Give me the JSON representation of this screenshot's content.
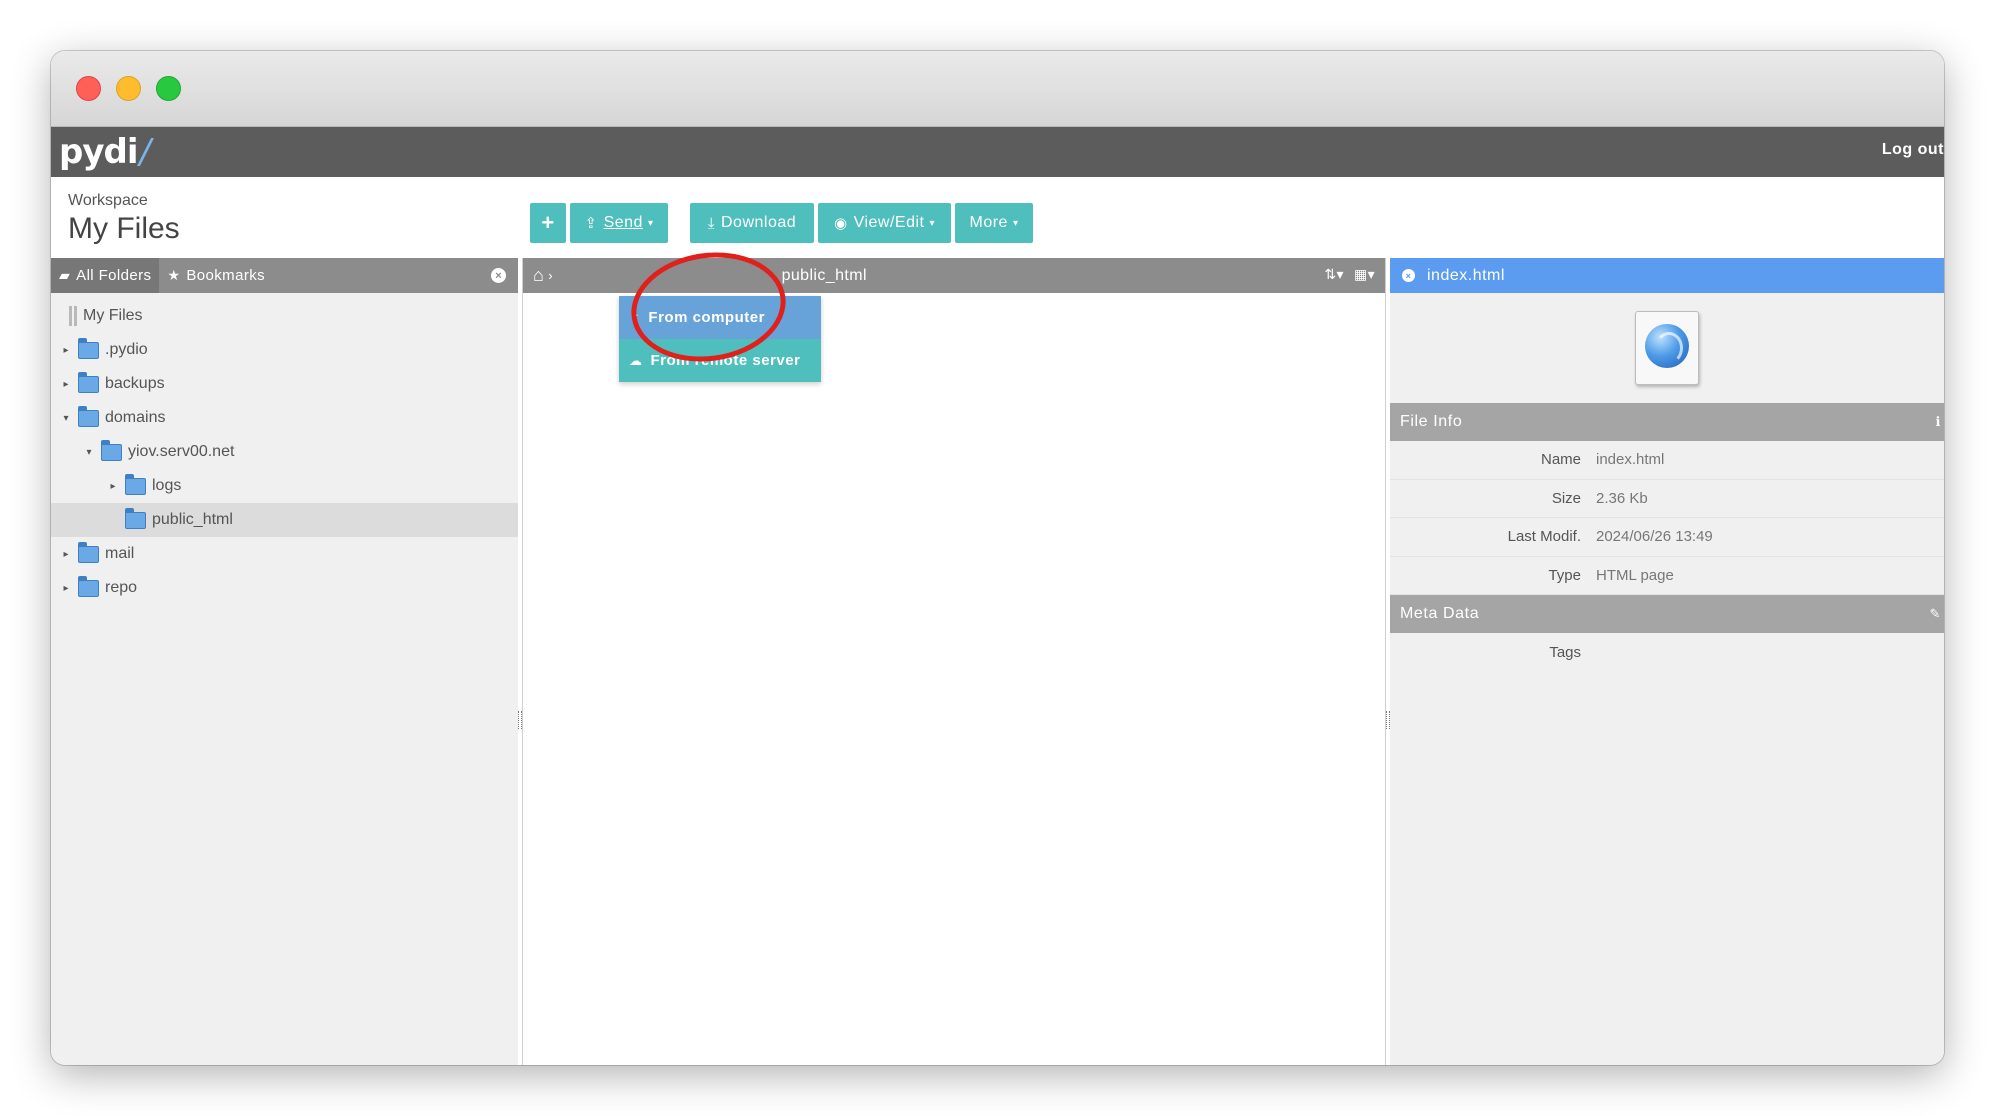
{
  "app": {
    "logo_text": "pydi",
    "logout_label": "Log out"
  },
  "workspace": {
    "label": "Workspace",
    "title": "My Files"
  },
  "toolbar": {
    "add_icon": "plus-icon",
    "send_label": "Send",
    "download_label": "Download",
    "view_edit_label": "View/Edit",
    "more_label": "More"
  },
  "send_menu": {
    "items": [
      {
        "label": "From computer",
        "icon": "upload-icon",
        "highlighted": true
      },
      {
        "label": "From remote server",
        "icon": "cloud-upload-icon",
        "highlighted": false
      }
    ]
  },
  "left_panel": {
    "tabs": [
      {
        "label": "All Folders",
        "icon": "folder-open-icon",
        "active": true
      },
      {
        "label": "Bookmarks",
        "icon": "star-icon",
        "active": false
      }
    ],
    "tree": [
      {
        "label": "My Files",
        "level": 0,
        "expander": "none",
        "icon": "drive-icon"
      },
      {
        "label": ".pydio",
        "level": 1,
        "expander": "collapsed",
        "icon": "folder-icon"
      },
      {
        "label": "backups",
        "level": 1,
        "expander": "collapsed",
        "icon": "folder-icon"
      },
      {
        "label": "domains",
        "level": 1,
        "expander": "expanded",
        "icon": "folder-icon"
      },
      {
        "label": "yiov.serv00.net",
        "level": 2,
        "expander": "expanded",
        "icon": "folder-icon"
      },
      {
        "label": "logs",
        "level": 3,
        "expander": "collapsed",
        "icon": "folder-icon"
      },
      {
        "label": "public_html",
        "level": 3,
        "expander": "none",
        "icon": "folder-icon",
        "selected": true
      },
      {
        "label": "mail",
        "level": 1,
        "expander": "collapsed",
        "icon": "folder-icon"
      },
      {
        "label": "repo",
        "level": 1,
        "expander": "collapsed",
        "icon": "folder-icon"
      }
    ]
  },
  "breadcrumb": {
    "current": "public_html"
  },
  "info_panel": {
    "filename": "index.html",
    "file_info_title": "File Info",
    "file_info": [
      {
        "key": "Name",
        "value": "index.html"
      },
      {
        "key": "Size",
        "value": "2.36 Kb"
      },
      {
        "key": "Last Modif.",
        "value": "2024/06/26 13:49"
      },
      {
        "key": "Type",
        "value": "HTML page"
      }
    ],
    "meta_title": "Meta Data",
    "meta": [
      {
        "key": "Tags",
        "value": ""
      }
    ]
  },
  "colors": {
    "accent_teal": "#4fbfbd",
    "selection_blue": "#5b9cf0",
    "annotation_red": "#e0201b"
  }
}
